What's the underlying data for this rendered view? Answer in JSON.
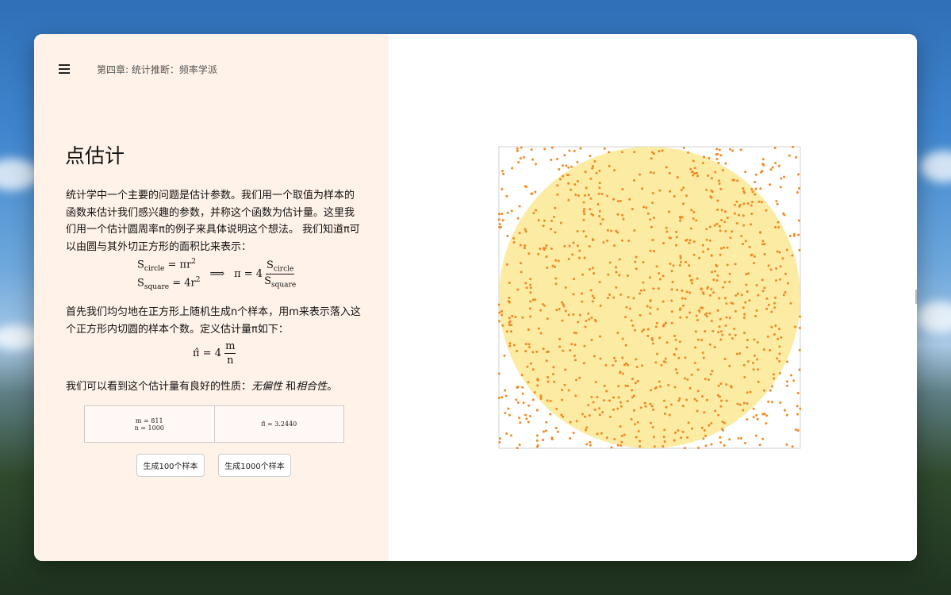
{
  "header": {
    "chapter": "第四章: 统计推断：频率学派"
  },
  "section": {
    "title": "点估计",
    "paragraph1": "统计学中一个主要的问题是估计参数。我们用一个取值为样本的函数来估计我们感兴趣的参数，并称这个函数为估计量。这里我们用一个估计圆周率π的例子来具体说明这个想法。 我们知道π可以由圆与其外切正方形的面积比来表示：",
    "paragraph2": "首先我们均匀地在正方形上随机生成n个样本，用m来表示落入这个正方形内切圆的样本个数。定义估计量π如下：",
    "paragraph3_prefix": "我们可以看到这个估计量有良好的性质：",
    "property1": "无偏性",
    "conjunction": " 和",
    "property2": "相合性",
    "paragraph3_suffix": "。"
  },
  "formula1": {
    "s_circle": "S",
    "circle_sub": "circle",
    "eq1": " = πr",
    "sq": "2",
    "s_square": "S",
    "square_sub": "square",
    "eq2": " = 4r",
    "arrow": "⟹",
    "pi_eq": "π = 4",
    "frac_num_s": "S",
    "frac_num_sub": "circle",
    "frac_den_s": "S",
    "frac_den_sub": "square"
  },
  "formula2": {
    "lhs": "π̂ = 4",
    "num": "m",
    "den": "n"
  },
  "stats": {
    "m_label": "m = 811",
    "n_label": "n = 1000",
    "pi_hat_label": "π̂ = 3.2440"
  },
  "buttons": {
    "gen100": "生成100个样本",
    "gen1000": "生成1000个样本"
  },
  "chart_data": {
    "type": "scatter",
    "description_of_marks": "uniform random samples on unit square",
    "n": 1000,
    "m": 811,
    "pi_hat": 3.244,
    "x_range": [
      0,
      1
    ],
    "y_range": [
      0,
      1
    ],
    "circle_center": [
      0.5,
      0.5
    ],
    "circle_radius": 0.5,
    "colors": {
      "circle_fill": "#fbeba3",
      "point": "#f08a24",
      "border": "#d0d0d0"
    },
    "seed": 7
  }
}
